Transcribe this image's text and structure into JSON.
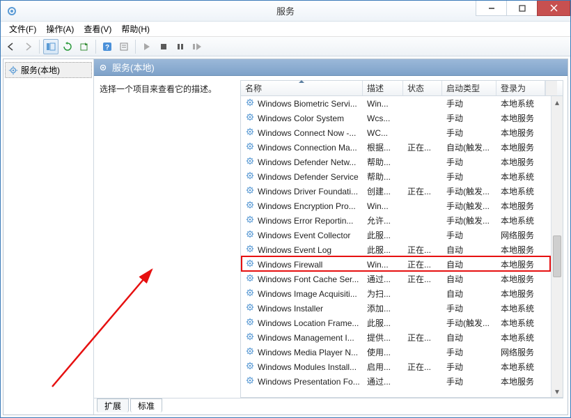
{
  "window": {
    "title": "服务"
  },
  "menu": {
    "file": "文件(F)",
    "action": "操作(A)",
    "view": "查看(V)",
    "help": "帮助(H)"
  },
  "tree": {
    "root": "服务(本地)"
  },
  "pane": {
    "header": "服务(本地)",
    "description_prompt": "选择一个项目来查看它的描述。"
  },
  "columns": {
    "name": "名称",
    "desc": "描述",
    "status": "状态",
    "startup": "启动类型",
    "logon": "登录为"
  },
  "tabs": {
    "extended": "扩展",
    "standard": "标准"
  },
  "highlight_index": 10,
  "services": [
    {
      "name": "Windows Biometric Servi...",
      "desc": "Win...",
      "status": "",
      "startup": "手动",
      "logon": "本地系统"
    },
    {
      "name": "Windows Color System",
      "desc": "Wcs...",
      "status": "",
      "startup": "手动",
      "logon": "本地服务"
    },
    {
      "name": "Windows Connect Now -...",
      "desc": "WC...",
      "status": "",
      "startup": "手动",
      "logon": "本地服务"
    },
    {
      "name": "Windows Connection Ma...",
      "desc": "根据...",
      "status": "正在...",
      "startup": "自动(触发...",
      "logon": "本地服务"
    },
    {
      "name": "Windows Defender Netw...",
      "desc": "帮助...",
      "status": "",
      "startup": "手动",
      "logon": "本地服务"
    },
    {
      "name": "Windows Defender Service",
      "desc": "帮助...",
      "status": "",
      "startup": "手动",
      "logon": "本地系统"
    },
    {
      "name": "Windows Driver Foundati...",
      "desc": "创建...",
      "status": "正在...",
      "startup": "手动(触发...",
      "logon": "本地系统"
    },
    {
      "name": "Windows Encryption Pro...",
      "desc": "Win...",
      "status": "",
      "startup": "手动(触发...",
      "logon": "本地服务"
    },
    {
      "name": "Windows Error Reportin...",
      "desc": "允许...",
      "status": "",
      "startup": "手动(触发...",
      "logon": "本地系统"
    },
    {
      "name": "Windows Event Collector",
      "desc": "此服...",
      "status": "",
      "startup": "手动",
      "logon": "网络服务"
    },
    {
      "name": "Windows Event Log",
      "desc": "此服...",
      "status": "正在...",
      "startup": "自动",
      "logon": "本地服务"
    },
    {
      "name": "Windows Firewall",
      "desc": "Win...",
      "status": "正在...",
      "startup": "自动",
      "logon": "本地服务"
    },
    {
      "name": "Windows Font Cache Ser...",
      "desc": "通过...",
      "status": "正在...",
      "startup": "自动",
      "logon": "本地服务"
    },
    {
      "name": "Windows Image Acquisiti...",
      "desc": "为扫...",
      "status": "",
      "startup": "自动",
      "logon": "本地服务"
    },
    {
      "name": "Windows Installer",
      "desc": "添加...",
      "status": "",
      "startup": "手动",
      "logon": "本地系统"
    },
    {
      "name": "Windows Location Frame...",
      "desc": "此服...",
      "status": "",
      "startup": "手动(触发...",
      "logon": "本地系统"
    },
    {
      "name": "Windows Management I...",
      "desc": "提供...",
      "status": "正在...",
      "startup": "自动",
      "logon": "本地系统"
    },
    {
      "name": "Windows Media Player N...",
      "desc": "使用...",
      "status": "",
      "startup": "手动",
      "logon": "网络服务"
    },
    {
      "name": "Windows Modules Install...",
      "desc": "启用...",
      "status": "正在...",
      "startup": "手动",
      "logon": "本地系统"
    },
    {
      "name": "Windows Presentation Fo...",
      "desc": "通过...",
      "status": "",
      "startup": "手动",
      "logon": "本地服务"
    }
  ]
}
